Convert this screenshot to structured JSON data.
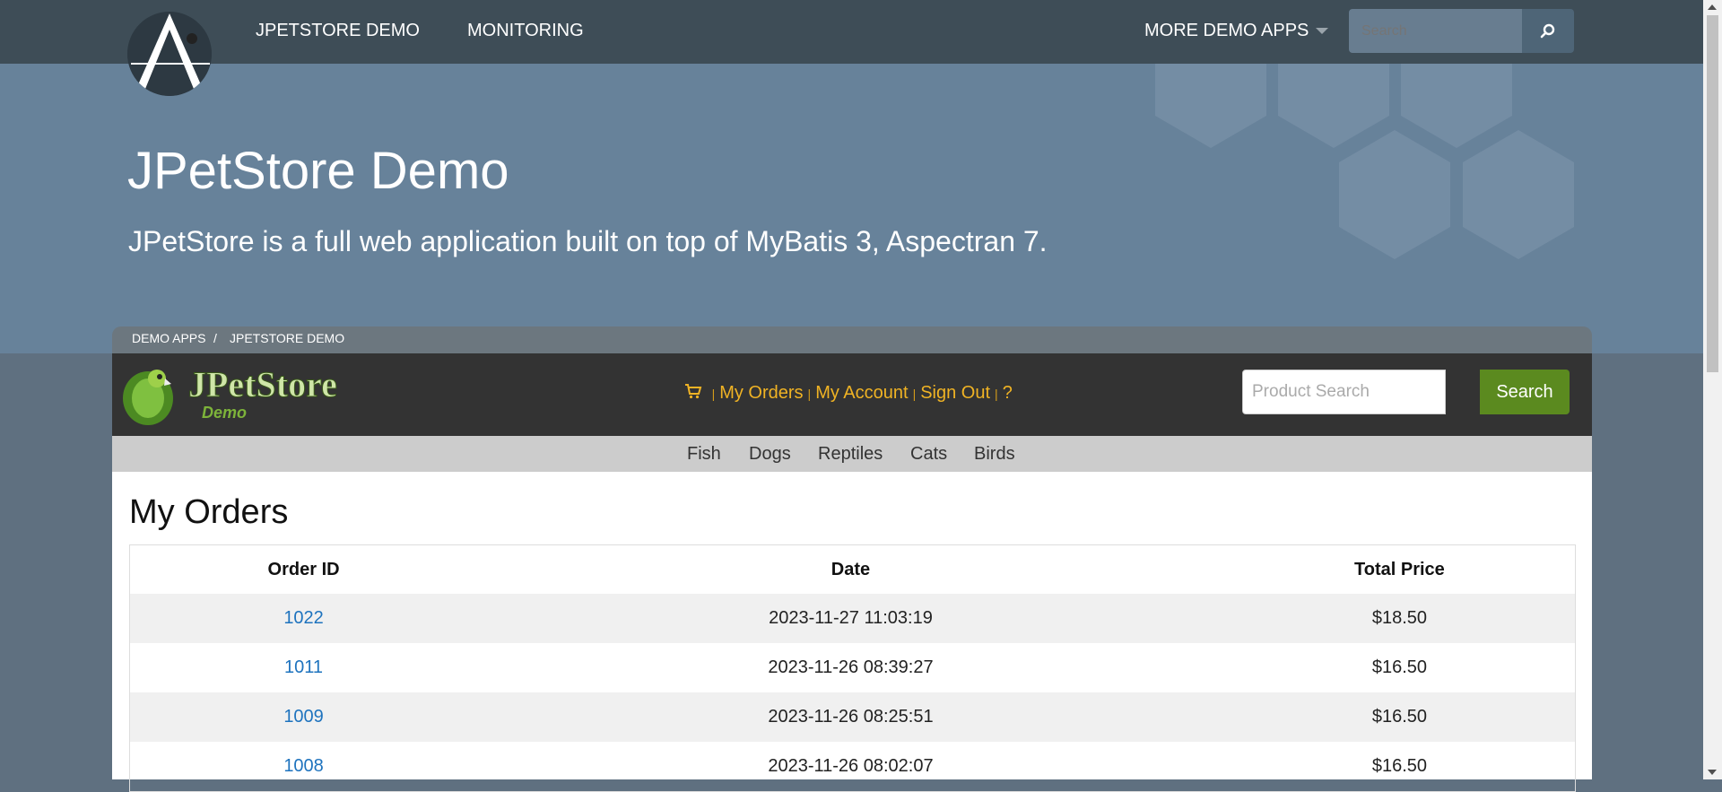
{
  "topnav": {
    "links": [
      "JPETSTORE DEMO",
      "MONITORING"
    ],
    "more_apps": "MORE DEMO APPS",
    "search_placeholder": "Search"
  },
  "hero": {
    "title": "JPetStore Demo",
    "subtitle": "JPetStore is a full web application built on top of MyBatis 3, Aspectran 7."
  },
  "breadcrumb": [
    "DEMO APPS",
    "/",
    "JPETSTORE DEMO"
  ],
  "store": {
    "logo_text": "JPetStore",
    "logo_sub": "Demo",
    "quick_links": [
      "My Orders",
      "My Account",
      "Sign Out",
      "?"
    ],
    "search_placeholder": "Product Search",
    "search_button": "Search",
    "categories": [
      "Fish",
      "Dogs",
      "Reptiles",
      "Cats",
      "Birds"
    ]
  },
  "orders": {
    "heading": "My Orders",
    "columns": [
      "Order ID",
      "Date",
      "Total Price"
    ],
    "rows": [
      {
        "id": "1022",
        "date": "2023-11-27 11:03:19",
        "total": "$18.50"
      },
      {
        "id": "1011",
        "date": "2023-11-26 08:39:27",
        "total": "$16.50"
      },
      {
        "id": "1009",
        "date": "2023-11-26 08:25:51",
        "total": "$16.50"
      },
      {
        "id": "1008",
        "date": "2023-11-26 08:02:07",
        "total": "$16.50"
      }
    ]
  },
  "colors": {
    "topnav": "#3e4d57",
    "hero": "#67829a",
    "store_header": "#333333",
    "link_orange": "#f0b324",
    "search_green": "#5b8a1f",
    "order_link": "#1e73be"
  }
}
